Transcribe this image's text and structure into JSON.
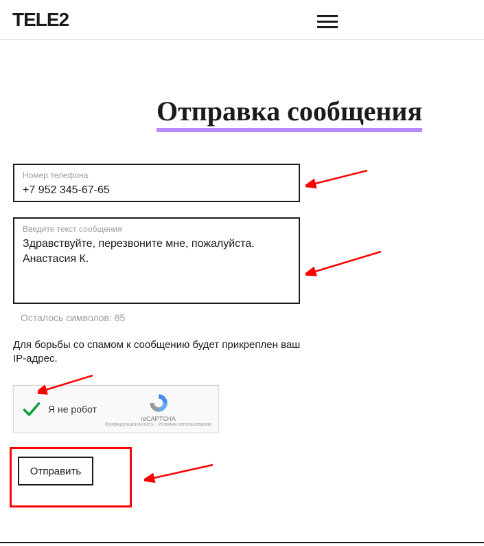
{
  "header": {
    "logo": "TELE2"
  },
  "page": {
    "title": "Отправка сообщения"
  },
  "form": {
    "phone_label": "Номер телефона",
    "phone_value": "+7 952 345-67-65",
    "msg_label": "Введите текст сообщения",
    "msg_value": "Здравствуйте, перезвоните мне, пожалуйста. Анастасия К.",
    "chars_left_text": "Осталось символов: 85",
    "spam_note": "Для борьбы со спамом к сообщению будет прикреплен ваш IP-адрес.",
    "submit_label": "Отправить"
  },
  "recaptcha": {
    "label": "Я не робот",
    "brand": "reCAPTCHA",
    "legal": "Конфиденциальность - Условия использования"
  }
}
